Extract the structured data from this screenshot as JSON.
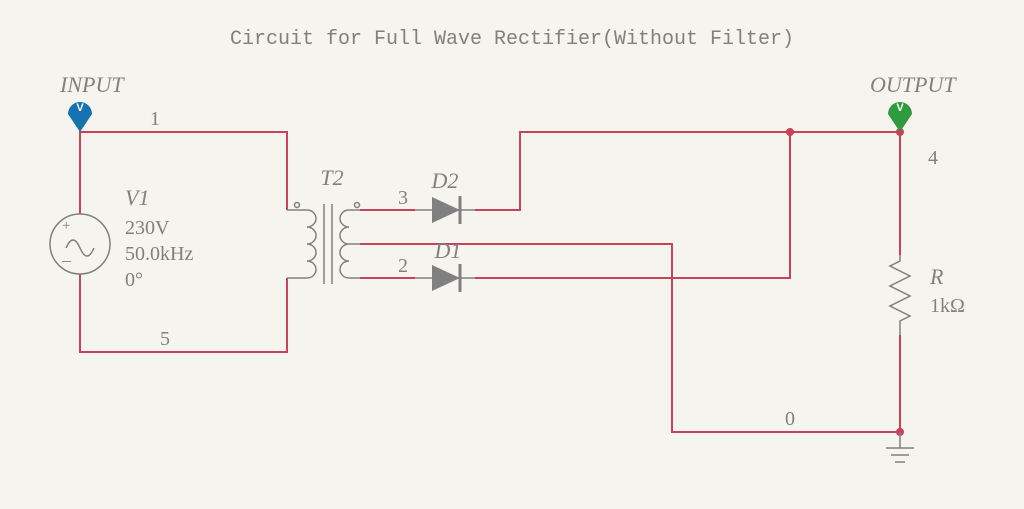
{
  "title": "Circuit for Full Wave Rectifier(Without Filter)",
  "labels": {
    "input": "INPUT",
    "output": "OUTPUT",
    "probe_letter": "V"
  },
  "components": {
    "V1": {
      "name": "V1",
      "voltage": "230V",
      "freq": "50.0kHz",
      "phase": "0°"
    },
    "T2": {
      "name": "T2"
    },
    "D1": {
      "name": "D1"
    },
    "D2": {
      "name": "D2"
    },
    "R": {
      "name": "R",
      "value": "1kΩ"
    }
  },
  "nets": {
    "n0": "0",
    "n1": "1",
    "n2": "2",
    "n3": "3",
    "n4": "4",
    "n5": "5"
  }
}
